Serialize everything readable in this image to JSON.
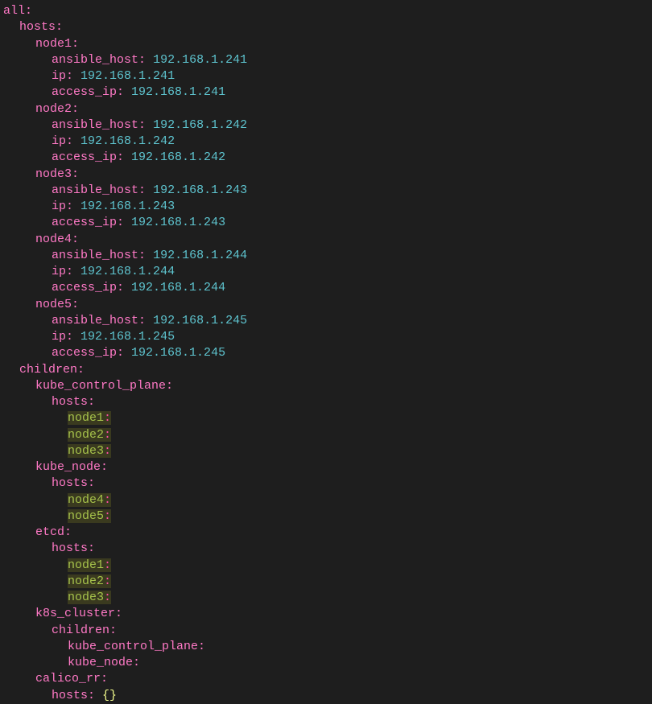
{
  "yaml": {
    "all": "all",
    "hosts": "hosts",
    "children": "children",
    "ip": "ip",
    "ansible_host": "ansible_host",
    "access_ip": "access_ip",
    "kube_control_plane": "kube_control_plane",
    "kube_node": "kube_node",
    "etcd": "etcd",
    "k8s_cluster": "k8s_cluster",
    "calico_rr": "calico_rr",
    "empty_obj": "{}"
  },
  "nodes": {
    "node1": {
      "name": "node1",
      "ansible_host": "192.168.1.241",
      "ip": "192.168.1.241",
      "access_ip": "192.168.1.241"
    },
    "node2": {
      "name": "node2",
      "ansible_host": "192.168.1.242",
      "ip": "192.168.1.242",
      "access_ip": "192.168.1.242"
    },
    "node3": {
      "name": "node3",
      "ansible_host": "192.168.1.243",
      "ip": "192.168.1.243",
      "access_ip": "192.168.1.243"
    },
    "node4": {
      "name": "node4",
      "ansible_host": "192.168.1.244",
      "ip": "192.168.1.244",
      "access_ip": "192.168.1.244"
    },
    "node5": {
      "name": "node5",
      "ansible_host": "192.168.1.245",
      "ip": "192.168.1.245",
      "access_ip": "192.168.1.245"
    }
  },
  "groups": {
    "kube_control_plane": [
      "node1",
      "node2",
      "node3"
    ],
    "kube_node": [
      "node4",
      "node5"
    ],
    "etcd": [
      "node1",
      "node2",
      "node3"
    ]
  }
}
